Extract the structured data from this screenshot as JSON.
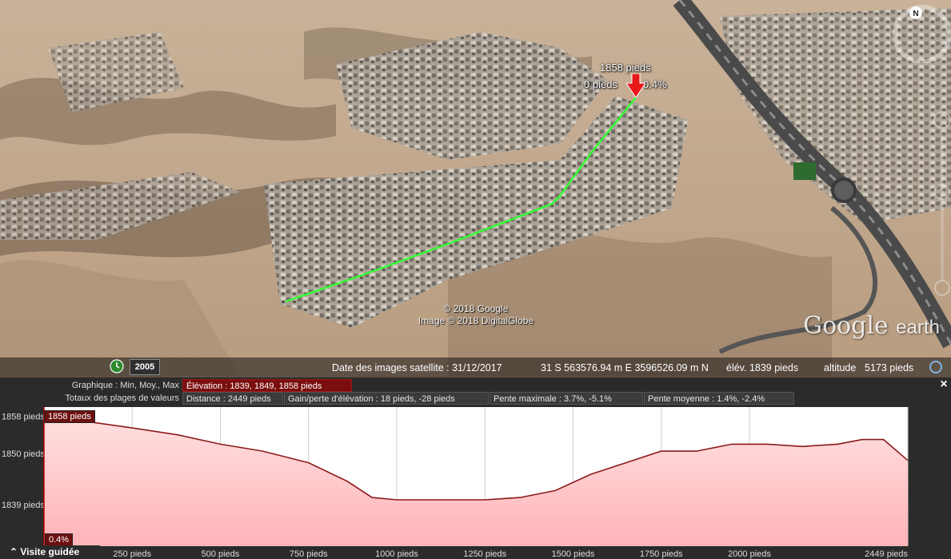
{
  "map": {
    "marker": {
      "elevation": "1858 pieds",
      "left_label": "0 pieds",
      "right_label": "0.4%"
    },
    "copyright": [
      "© 2018 Google",
      "Image © 2018 DigitalGlobe"
    ],
    "logo": {
      "main": "Google",
      "sub": "earth"
    },
    "compass_letter": "N",
    "year_button": "2005",
    "status": {
      "imagery_date": "Date des images satellite : 31/12/2017",
      "coords": "31 S 563576.94 m E 3596526.09 m N",
      "elevation": "élév. 1839 pieds",
      "altitude_label": "altitude",
      "altitude_value": "5173 pieds"
    },
    "path_color": "#33ff33"
  },
  "profile": {
    "row1": {
      "label": "Graphique : Min, Moy., Max",
      "value": "Élévation : 1839, 1849, 1858 pieds"
    },
    "row2": {
      "label": "Totaux des plages de valeurs",
      "distance": "Distance : 2449 pieds",
      "gain": "Gain/perte d'élévation : 18 pieds, -28 pieds",
      "max_slope": "Pente maximale : 3.7%, -5.1%",
      "avg_slope": "Pente moyenne : 1.4%, -2.4%"
    },
    "close": "×",
    "cursor_elev_tag": "1858 pieds",
    "cursor_slope_tag": "0.4%",
    "tour": "Visite guidée"
  },
  "chart_data": {
    "type": "area",
    "xlabel": "",
    "ylabel": "",
    "ylim": [
      1830,
      1860
    ],
    "xlim": [
      0,
      2449
    ],
    "y_ticks": [
      {
        "value": 1858,
        "label": "1858 pieds"
      },
      {
        "value": 1850,
        "label": "1850 pieds"
      },
      {
        "value": 1839,
        "label": "1839 pieds"
      }
    ],
    "x_ticks": [
      {
        "value": 250,
        "label": "250 pieds"
      },
      {
        "value": 500,
        "label": "500 pieds"
      },
      {
        "value": 750,
        "label": "750 pieds"
      },
      {
        "value": 1000,
        "label": "1000 pieds"
      },
      {
        "value": 1250,
        "label": "1250 pieds"
      },
      {
        "value": 1500,
        "label": "1500 pieds"
      },
      {
        "value": 1750,
        "label": "1750 pieds"
      },
      {
        "value": 2000,
        "label": "2000 pieds"
      },
      {
        "value": 2449,
        "label": "2449 pieds"
      }
    ],
    "series": [
      {
        "x": [
          0,
          110,
          250,
          380,
          500,
          620,
          750,
          860,
          930,
          1000,
          1100,
          1250,
          1350,
          1450,
          1550,
          1650,
          1750,
          1850,
          1950,
          2050,
          2150,
          2250,
          2320,
          2380,
          2449
        ],
        "y": [
          1858,
          1857,
          1855.5,
          1854,
          1852,
          1850.5,
          1848,
          1844,
          1840.5,
          1840,
          1840,
          1840,
          1840.5,
          1842,
          1845.5,
          1848,
          1850.5,
          1850.5,
          1852,
          1852,
          1851.5,
          1852,
          1853,
          1853,
          1848.5
        ],
        "color": "#8b1a1a"
      }
    ]
  }
}
